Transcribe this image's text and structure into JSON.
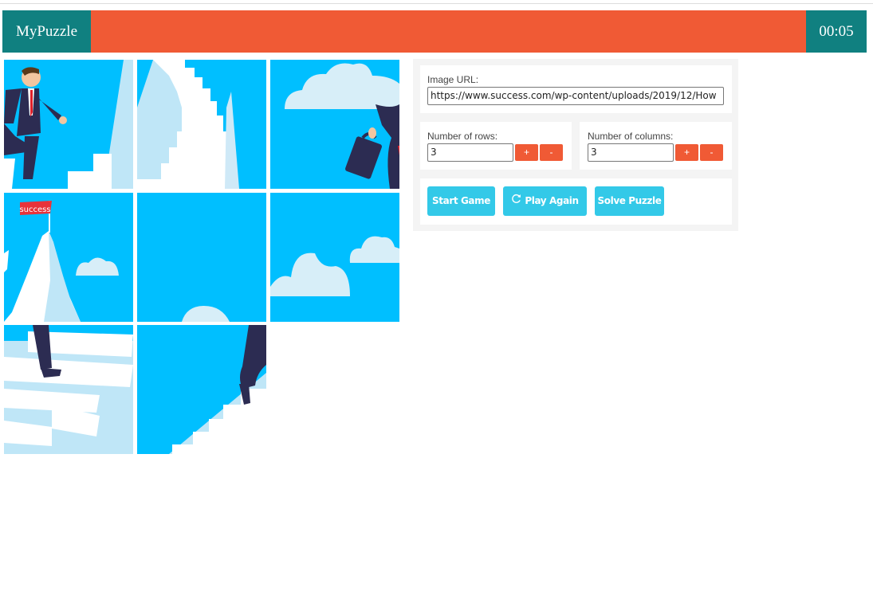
{
  "header": {
    "brand": "MyPuzzle",
    "timer": "00:05",
    "colors": {
      "bar": "#f05a35",
      "brand_bg": "#108080"
    }
  },
  "board": {
    "rows": 3,
    "columns": 3,
    "tiles": [
      {
        "slot": 1,
        "piece": "man-running-with-tie"
      },
      {
        "slot": 2,
        "piece": "white-staircase-top"
      },
      {
        "slot": 3,
        "piece": "cloud-and-briefcase"
      },
      {
        "slot": 4,
        "piece": "peak-with-flag"
      },
      {
        "slot": 5,
        "piece": "sky-with-cloud-edge"
      },
      {
        "slot": 6,
        "piece": "clouds"
      },
      {
        "slot": 7,
        "piece": "stairs-with-foot"
      },
      {
        "slot": 8,
        "piece": "stairs-and-legs"
      },
      {
        "slot": 9,
        "piece": "empty"
      }
    ],
    "flag_text": "success"
  },
  "controls": {
    "image_url_label": "Image URL:",
    "image_url_value": "https://www.success.com/wp-content/uploads/2019/12/How",
    "rows_label": "Number of rows:",
    "rows_value": "3",
    "columns_label": "Number of columns:",
    "columns_value": "3",
    "increment_label": "+",
    "decrement_label": "-",
    "start_game_label": "Start Game",
    "play_again_label": "Play Again",
    "solve_puzzle_label": "Solve Puzzle",
    "play_again_icon": "refresh-icon"
  }
}
